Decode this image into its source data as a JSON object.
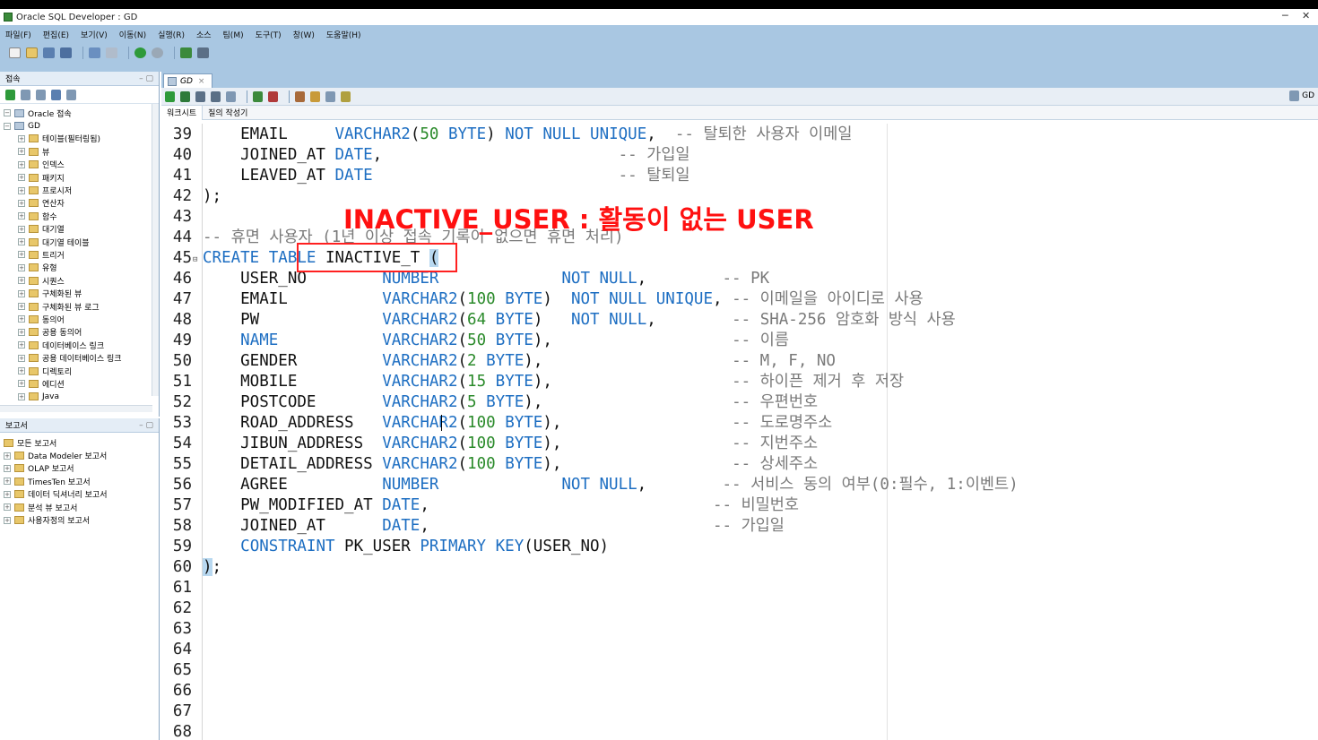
{
  "window": {
    "title": "Oracle SQL Developer : GD",
    "minimize": "─",
    "close": "✕"
  },
  "menubar": [
    "파일(F)",
    "편집(E)",
    "보기(V)",
    "이동(N)",
    "실행(R)",
    "소스",
    "팀(M)",
    "도구(T)",
    "창(W)",
    "도움말(H)"
  ],
  "connections_panel": {
    "title": "접속",
    "root": "Oracle 접속",
    "connection": "GD",
    "items": [
      "테이블(필터링됨)",
      "뷰",
      "인덱스",
      "패키지",
      "프로시저",
      "연산자",
      "함수",
      "대기열",
      "대기열 테이블",
      "트리거",
      "유형",
      "시퀀스",
      "구체화된 뷰",
      "구체화된 뷰 로그",
      "동의어",
      "공용 동의어",
      "데이터베이스 링크",
      "공용 데이터베이스 링크",
      "디렉토리",
      "에디션",
      "Java"
    ]
  },
  "reports_panel": {
    "title": "보고서",
    "items": [
      "모든 보고서",
      "Data Modeler 보고서",
      "OLAP 보고서",
      "TimesTen 보고서",
      "데이터 딕셔너리 보고서",
      "분석 뷰 보고서",
      "사용자정의 보고서"
    ]
  },
  "editor": {
    "tab": "GD",
    "connection_label": "GD",
    "subtabs": [
      "워크시트",
      "질의 작성기"
    ]
  },
  "annotation": {
    "title": "INACTIVE_USER : 활동이 없는 USER"
  },
  "code_lines": [
    {
      "n": "39",
      "html": "    EMAIL     <span class='kw'>VARCHAR2</span>(<span class='num'>50</span> <span class='kw'>BYTE</span>) <span class='kw'>NOT NULL UNIQUE</span>,  <span class='cm'>-- 탈퇴한 사용자 이메일</span>"
    },
    {
      "n": "40",
      "html": "    JOINED_AT <span class='kw'>DATE</span>,                         <span class='cm'>-- 가입일</span>"
    },
    {
      "n": "41",
      "html": "    LEAVED_AT <span class='kw'>DATE</span>                          <span class='cm'>-- 탈퇴일</span>"
    },
    {
      "n": "42",
      "html": ");"
    },
    {
      "n": "43",
      "html": ""
    },
    {
      "n": "44",
      "html": "<span class='cm'>-- 휴면 사용자 (1년 이상 접속 기록이 없으면 휴면 처리)</span>"
    },
    {
      "n": "45",
      "fold": true,
      "html": "<span class='kw'>CREATE TABLE</span> INACTIVE_T <span class='cursor-hl'>(</span>"
    },
    {
      "n": "46",
      "html": "    USER_NO        <span class='kw'>NUMBER</span>             <span class='kw'>NOT NULL</span>,        <span class='cm'>-- PK</span>"
    },
    {
      "n": "47",
      "html": "    EMAIL          <span class='kw'>VARCHAR2</span>(<span class='num'>100</span> <span class='kw'>BYTE</span>)  <span class='kw'>NOT NULL UNIQUE</span>, <span class='cm'>-- 이메일을 아이디로 사용</span>"
    },
    {
      "n": "48",
      "html": "    PW             <span class='kw'>VARCHAR2</span>(<span class='num'>64</span> <span class='kw'>BYTE</span>)   <span class='kw'>NOT NULL</span>,        <span class='cm'>-- SHA-256 암호화 방식 사용</span>"
    },
    {
      "n": "49",
      "html": "    <span class='kw'>NAME</span>           <span class='kw'>VARCHAR2</span>(<span class='num'>50</span> <span class='kw'>BYTE</span>),                   <span class='cm'>-- 이름</span>"
    },
    {
      "n": "50",
      "html": "    GENDER         <span class='kw'>VARCHAR2</span>(<span class='num'>2</span> <span class='kw'>BYTE</span>),                    <span class='cm'>-- M, F, NO</span>"
    },
    {
      "n": "51",
      "html": "    MOBILE         <span class='kw'>VARCHAR2</span>(<span class='num'>15</span> <span class='kw'>BYTE</span>),                   <span class='cm'>-- 하이픈 제거 후 저장</span>"
    },
    {
      "n": "52",
      "html": "    POSTCODE       <span class='kw'>VARCHAR2</span>(<span class='num'>5</span> <span class='kw'>BYTE</span>),                    <span class='cm'>-- 우편번호</span>"
    },
    {
      "n": "53",
      "html": "    ROAD_ADDRESS   <span class='kw'>VARCHAR2</span>(<span class='num'>100</span> <span class='kw'>BYTE</span>),                  <span class='cm'>-- 도로명주소</span>"
    },
    {
      "n": "54",
      "html": "    JIBUN_ADDRESS  <span class='kw'>VARCHAR2</span>(<span class='num'>100</span> <span class='kw'>BYTE</span>),                  <span class='cm'>-- 지번주소</span>"
    },
    {
      "n": "55",
      "html": "    DETAIL_ADDRESS <span class='kw'>VARCHAR2</span>(<span class='num'>100</span> <span class='kw'>BYTE</span>),                  <span class='cm'>-- 상세주소</span>"
    },
    {
      "n": "56",
      "html": "    AGREE          <span class='kw'>NUMBER</span>             <span class='kw'>NOT NULL</span>,        <span class='cm'>-- 서비스 동의 여부(0:필수, 1:이벤트)</span>"
    },
    {
      "n": "57",
      "html": "    PW_MODIFIED_AT <span class='kw'>DATE</span>,                              <span class='cm'>-- 비밀번호</span>"
    },
    {
      "n": "58",
      "html": "    JOINED_AT      <span class='kw'>DATE</span>,                              <span class='cm'>-- 가입일</span>"
    },
    {
      "n": "59",
      "html": "    <span class='kw'>CONSTRAINT</span> PK_USER <span class='kw'>PRIMARY KEY</span>(USER_NO)"
    },
    {
      "n": "60",
      "html": "<span class='cursor-hl'>)</span>;"
    },
    {
      "n": "61",
      "html": ""
    },
    {
      "n": "62",
      "html": ""
    },
    {
      "n": "63",
      "html": ""
    },
    {
      "n": "64",
      "html": ""
    },
    {
      "n": "65",
      "html": ""
    },
    {
      "n": "66",
      "html": ""
    },
    {
      "n": "67",
      "html": ""
    },
    {
      "n": "68",
      "html": ""
    }
  ]
}
